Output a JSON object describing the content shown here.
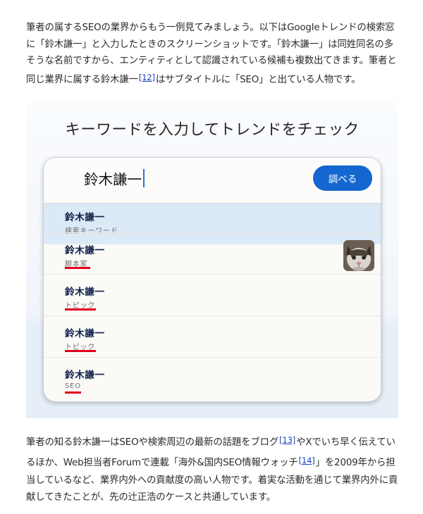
{
  "article": {
    "para1": {
      "before_fn": "筆者の属するSEOの業界からもう一例見てみましょう。以下はGoogleトレンドの検索窓に「鈴木謙一」と入力したときのスクリーンショットです。「鈴木謙一」は同姓同名の多そうな名前ですから、エンティティとして認識されている候補も複数出てきます。筆者と同じ業界に属する鈴木謙一",
      "fn": "[12]",
      "after_fn": "はサブタイトルに「SEO」と出ている人物です。"
    },
    "para2": {
      "part1": "筆者の知る鈴木謙一はSEOや検索周辺の最新の話題をブログ",
      "fn1": "[13]",
      "part2": "やXでいち早く伝えているほか、Web担当者Forumで連載「海外&国内SEO情報ウォッチ",
      "fn2": "[14]",
      "part3": "」を2009年から担当しているなど、業界内外への貢献度の高い人物です。着実な活動を通じて業界内外に貢献してきたことが、先の辻正浩のケースと共通しています。"
    }
  },
  "figure": {
    "title": "キーワードを入力してトレンドをチェック",
    "search": {
      "query": "鈴木謙一",
      "button_label": "調べる"
    },
    "suggestions": [
      {
        "name": "鈴木謙一",
        "type": "検索キーワード",
        "highlighted": true,
        "underlined": false,
        "has_thumbnail": false
      },
      {
        "name": "鈴木謙一",
        "type": "脚本家",
        "highlighted": false,
        "underlined": true,
        "has_thumbnail": true
      },
      {
        "name": "鈴木謙一",
        "type": "トピック",
        "highlighted": false,
        "underlined": true,
        "has_thumbnail": false
      },
      {
        "name": "鈴木謙一",
        "type": "トピック",
        "highlighted": false,
        "underlined": true,
        "has_thumbnail": false
      },
      {
        "name": "鈴木謙一",
        "type": "SEO",
        "highlighted": false,
        "underlined": true,
        "has_thumbnail": false
      }
    ],
    "colors": {
      "accent_button": "#1467d0",
      "highlight_row": "#dce9f6",
      "annotation_underline": "#e0001a"
    }
  }
}
